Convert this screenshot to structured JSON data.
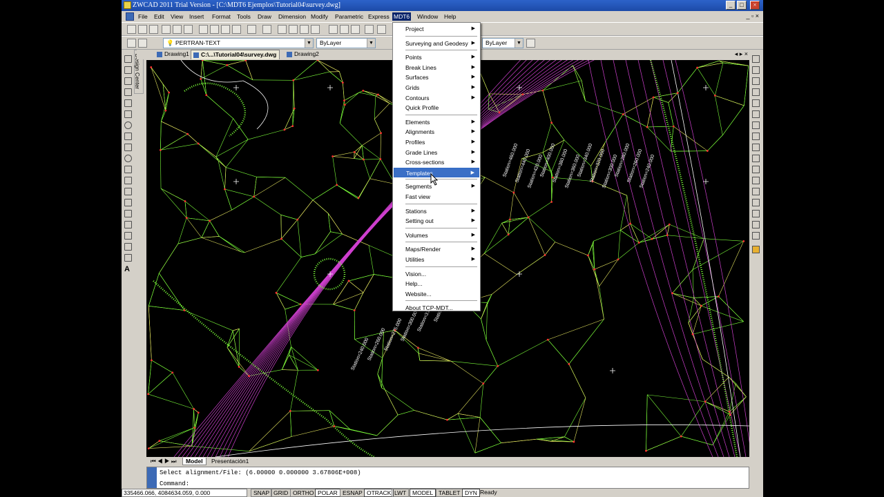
{
  "window": {
    "title": "ZWCAD 2011 Trial Version - [C:\\MDT6 Ejemplos\\Tutorial04\\survey.dwg]",
    "controls": [
      "_",
      "□",
      "×"
    ]
  },
  "menubar": {
    "items": [
      "File",
      "Edit",
      "View",
      "Insert",
      "Format",
      "Tools",
      "Draw",
      "Dimension",
      "Modify",
      "Parametric",
      "Express",
      "MDT6",
      "Window",
      "Help"
    ],
    "active": "MDT6"
  },
  "toolbar2": {
    "layer_name": "PERTRAN-TEXT",
    "color": "ByLayer",
    "lineweight": "ByLayer"
  },
  "doc_tabs": [
    {
      "label": "Drawing1",
      "active": false
    },
    {
      "label": "C:\\...\\Tutorial04\\survey.dwg",
      "active": true
    },
    {
      "label": "Drawing2",
      "active": false
    }
  ],
  "design_center_label": "Design Center",
  "mdt6_menu": {
    "items": [
      {
        "label": "Project",
        "submenu": true
      },
      {
        "sep": true
      },
      {
        "label": "Surveying and Geodesy",
        "submenu": true
      },
      {
        "sep": true
      },
      {
        "label": "Points",
        "submenu": true
      },
      {
        "label": "Break Lines",
        "submenu": true
      },
      {
        "label": "Surfaces",
        "submenu": true
      },
      {
        "label": "Grids",
        "submenu": true
      },
      {
        "label": "Contours",
        "submenu": true
      },
      {
        "label": "Quick Profile",
        "submenu": false
      },
      {
        "sep": true
      },
      {
        "label": "Elements",
        "submenu": true
      },
      {
        "label": "Alignments",
        "submenu": true
      },
      {
        "label": "Profiles",
        "submenu": true
      },
      {
        "label": "Grade Lines",
        "submenu": true
      },
      {
        "label": "Cross-sections",
        "submenu": true
      },
      {
        "label": "Templates",
        "submenu": true,
        "highlighted": true
      },
      {
        "sep": true
      },
      {
        "label": "Segments",
        "submenu": true
      },
      {
        "label": "Fast view",
        "submenu": false
      },
      {
        "sep": true
      },
      {
        "label": "Stations",
        "submenu": true
      },
      {
        "label": "Setting out",
        "submenu": true
      },
      {
        "sep": true
      },
      {
        "label": "Volumes",
        "submenu": true
      },
      {
        "sep": true
      },
      {
        "label": "Maps/Render",
        "submenu": true
      },
      {
        "label": "Utilities",
        "submenu": true
      },
      {
        "sep": true
      },
      {
        "label": "Vision...",
        "submenu": false
      },
      {
        "label": "Help...",
        "submenu": false
      },
      {
        "label": "Website...",
        "submenu": false
      },
      {
        "sep": true
      },
      {
        "label": "About TCP-MDT...",
        "submenu": false
      }
    ]
  },
  "layout_tabs": {
    "model": "Model",
    "layout1": "Presentación1"
  },
  "command": {
    "history": "Select alignment/File: (6.00000 0.000000 3.67806E+008)",
    "prompt": "Command:"
  },
  "status": {
    "coords": "335466.066,  4084634.059,  0.000",
    "buttons": [
      "SNAP",
      "GRID",
      "ORTHO",
      "POLAR",
      "ESNAP",
      "OTRACK",
      "LWT",
      "MODEL",
      "TABLET",
      "DYN"
    ],
    "on": [
      "POLAR",
      "OTRACK",
      "MODEL",
      "DYN"
    ],
    "state": "Ready"
  },
  "drawing_labels": [
    "Station=460.000",
    "Station=440.000",
    "Station=420.000",
    "Station=400.000",
    "Station=380.000",
    "Station=360.000",
    "Station=340.000",
    "Station=320.000",
    "Station=300.000",
    "Station=280.000",
    "Station=260.000",
    "Station=240.000",
    "Station=335.000",
    "Station=310.000",
    "Station=300.000",
    "Station=275.000",
    "Station=260.000",
    "Station=240.000"
  ],
  "colors": {
    "accent": "#0a246a",
    "mesh_green": "#7cff3a",
    "contour_magenta": "#d040d0",
    "edge_yellow": "#e8e860"
  }
}
